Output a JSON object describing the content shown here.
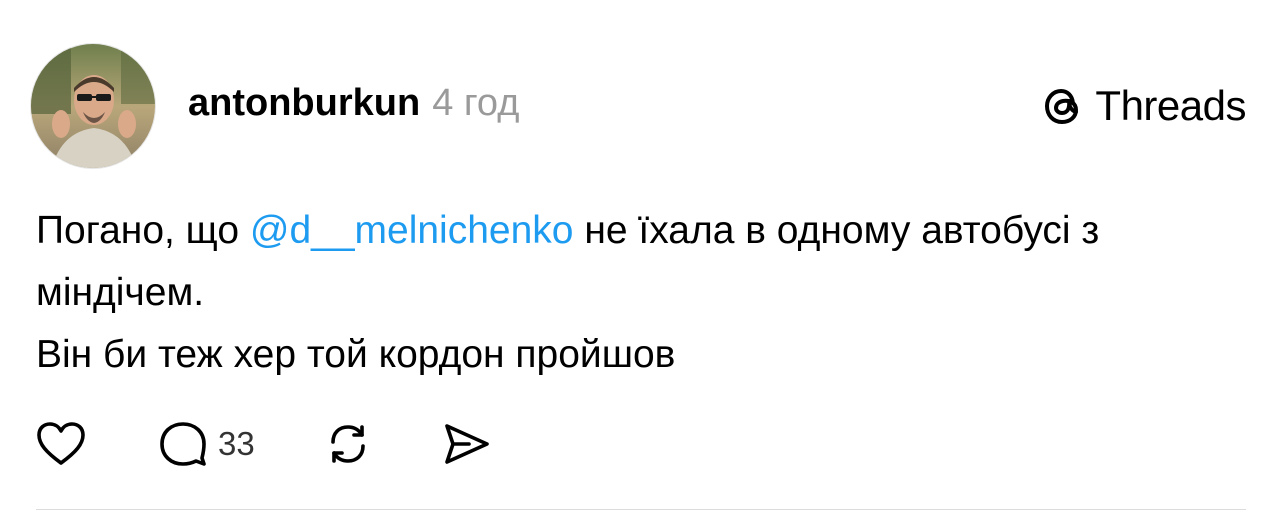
{
  "post": {
    "author": {
      "username": "antonburkun",
      "avatar_icon": "avatar-photo"
    },
    "timestamp": "4 год",
    "brand": {
      "name": "Threads",
      "logo_icon": "threads-logo-icon"
    },
    "body": {
      "line1_prefix": "Погано, що ",
      "mention": "@d__melnichenko",
      "line1_suffix": " не їхала в одному автобусі з міндічем.",
      "line2": "Він би теж хер той кордон пройшов"
    },
    "actions": {
      "like_icon": "heart-icon",
      "reply_icon": "reply-bubble-icon",
      "reply_count": "33",
      "repost_icon": "repost-icon",
      "share_icon": "send-icon"
    }
  },
  "colors": {
    "mention": "#1d9bf0",
    "timestamp": "#9a9a9a",
    "divider": "#dcdcdc"
  }
}
